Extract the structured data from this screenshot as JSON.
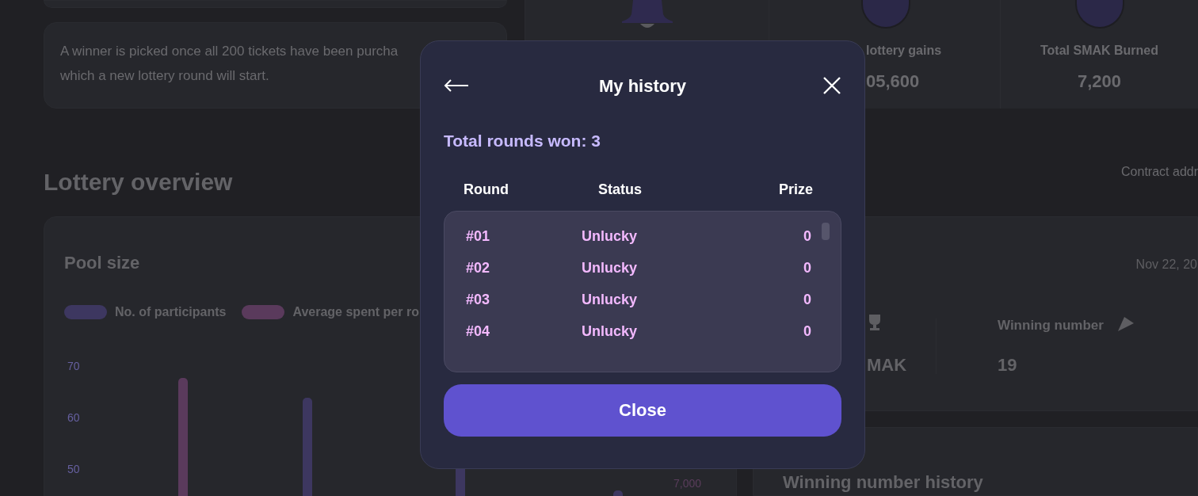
{
  "background": {
    "info_lines": [
      "A winner is picked once all 200 tickets have been purcha",
      "which a new lottery round will start."
    ],
    "section_title": "Lottery overview",
    "stats": [
      {
        "label": "lottery gains",
        "value": "05,600"
      },
      {
        "label": "Total SMAK Burned",
        "value": "7,200"
      }
    ],
    "contract_label": "Contract addr",
    "pool_card": {
      "title": "Pool size",
      "legend": [
        {
          "label": "No. of participants",
          "color": "#3d3760"
        },
        {
          "label": "Average spent per ro",
          "color": "#5a3a5c"
        }
      ],
      "y_ticks": [
        "70",
        "60",
        "50"
      ],
      "right_tick": "7,000"
    },
    "round_card": {
      "date": "Nov 22, 20",
      "prize_fragment": "MAK",
      "winning_label": "Winning number",
      "winning_value": "19"
    },
    "history_title": "Winning number history"
  },
  "modal": {
    "title": "My history",
    "summary": "Total rounds won: 3",
    "columns": [
      "Round",
      "Status",
      "Prize"
    ],
    "rows": [
      {
        "round": "#01",
        "status": "Unlucky",
        "prize": "0"
      },
      {
        "round": "#02",
        "status": "Unlucky",
        "prize": "0"
      },
      {
        "round": "#03",
        "status": "Unlucky",
        "prize": "0"
      },
      {
        "round": "#04",
        "status": "Unlucky",
        "prize": "0"
      }
    ],
    "close_button": "Close"
  }
}
